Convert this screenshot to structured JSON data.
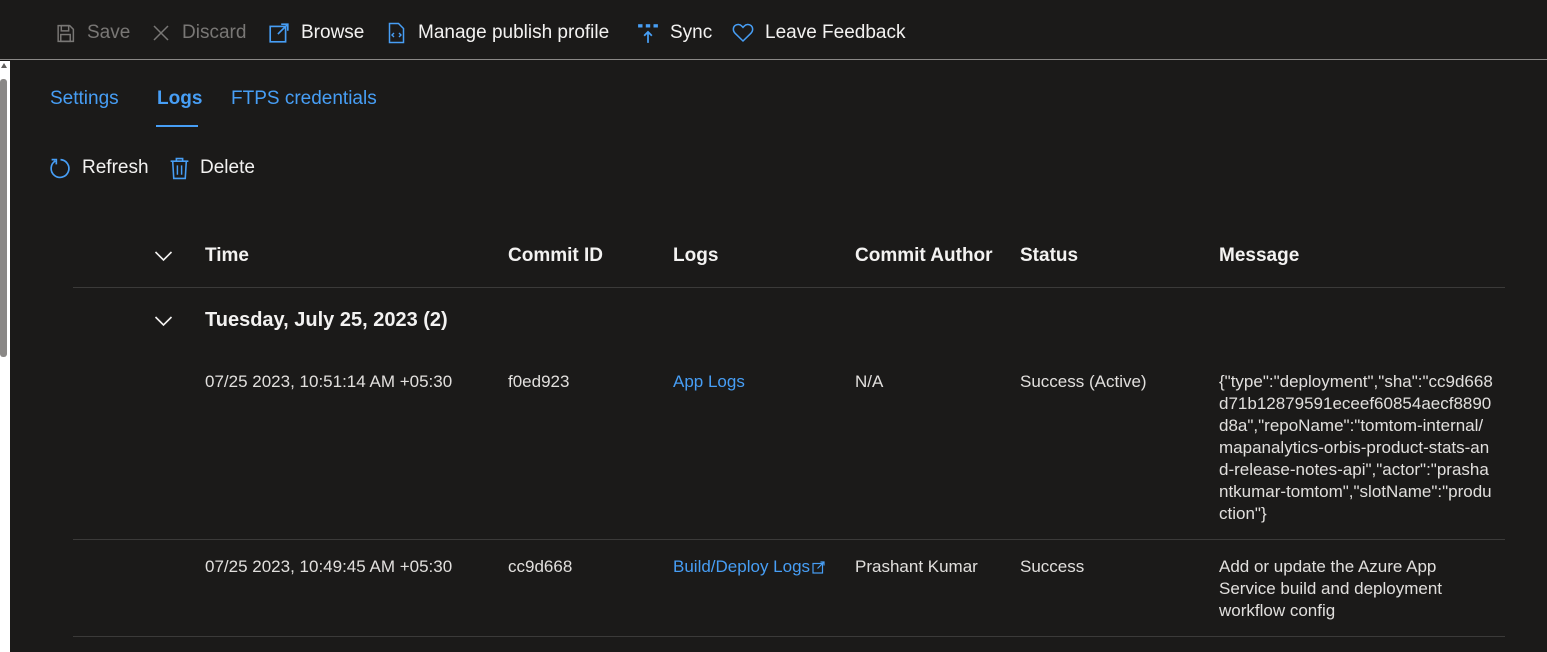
{
  "commandbar": {
    "save": "Save",
    "discard": "Discard",
    "browse": "Browse",
    "manage_publish_profile": "Manage publish profile",
    "sync": "Sync",
    "leave_feedback": "Leave Feedback"
  },
  "tabs": {
    "settings": "Settings",
    "logs": "Logs",
    "ftps": "FTPS credentials"
  },
  "actions": {
    "refresh": "Refresh",
    "delete": "Delete"
  },
  "table": {
    "headers": {
      "time": "Time",
      "commit_id": "Commit ID",
      "logs": "Logs",
      "commit_author": "Commit Author",
      "status": "Status",
      "message": "Message"
    },
    "group_title": "Tuesday, July 25, 2023 (2)",
    "rows": [
      {
        "time": "07/25 2023, 10:51:14 AM +05:30",
        "commit_id": "f0ed923",
        "logs": "App Logs",
        "author": "N/A",
        "status": "Success (Active)",
        "message": "{\"type\":\"deployment\",\"sha\":\"cc9d668d71b12879591eceef60854aecf8890d8a\",\"repoName\":\"tomtom-internal/mapanalytics-orbis-product-stats-and-release-notes-api\",\"actor\":\"prashantkumar-tomtom\",\"slotName\":\"production\"}"
      },
      {
        "time": "07/25 2023, 10:49:45 AM +05:30",
        "commit_id": "cc9d668",
        "logs": "Build/Deploy Logs",
        "author": "Prashant Kumar",
        "status": "Success",
        "message": "Add or update the Azure App Service build and deployment workflow config"
      }
    ]
  },
  "colors": {
    "background": "#1b1a19",
    "accent": "#479ef5",
    "text": "#f3f2f1",
    "disabled": "#797775"
  }
}
